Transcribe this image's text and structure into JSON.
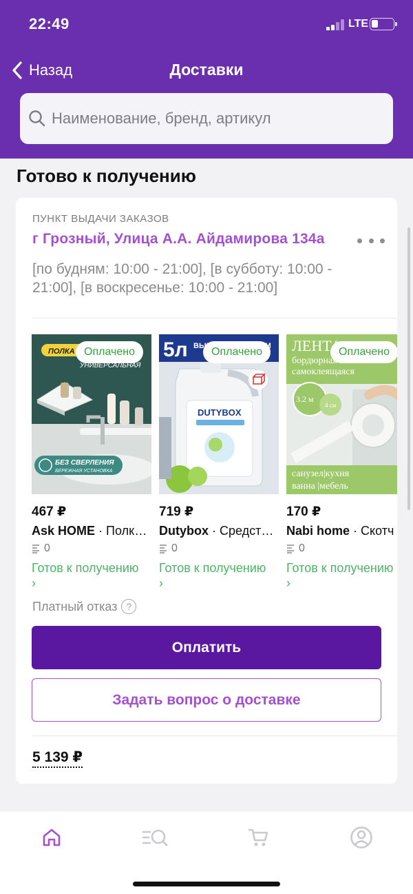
{
  "status_bar": {
    "time": "22:49",
    "network": "LTE"
  },
  "nav": {
    "back_label": "Назад",
    "title": "Доставки"
  },
  "search": {
    "placeholder": "Наименование, бренд, артикул"
  },
  "section": {
    "title": "Готово к получению"
  },
  "pickup": {
    "label": "ПУНКТ ВЫДАЧИ ЗАКАЗОВ",
    "address": "г Грозный, Улица А.А. Айдамирова 134а",
    "hours": "[по будням: 10:00 - 21:00], [в субботу: 10:00 - 21:00], [в воскресенье: 10:00 - 21:00]"
  },
  "products": [
    {
      "badge": "Оплачено",
      "price": "467 ₽",
      "brand": "Ask HOME",
      "name": " · Полка для ванной",
      "reviews": "0",
      "status": "Готов к получению",
      "chevron": "›",
      "image_text": {
        "line1": "ПОЛКА",
        "line2": "УНИВЕРСАЛЬНАЯ",
        "footer1": "БЕЗ СВЕРЛЕНИЯ",
        "footer2": "БЕРЕЖНАЯ УСТАНОВКА"
      },
      "colors": {
        "bg": "#2e5752",
        "badge_text": "#33a33a"
      }
    },
    {
      "badge": "Оплачено",
      "price": "719 ₽",
      "brand": "Dutybox",
      "name": " · Средство для посудомоечной машины",
      "reviews": "0",
      "status": "Готов к получению",
      "chevron": "›",
      "image_text": {
        "volume": "5л",
        "headline": "ВЫГОДНЫЙ ОБЪЕМ",
        "logo": "DUTYBOX"
      },
      "colors": {
        "bg": "#1d3a8f"
      }
    },
    {
      "badge": "Оплачено",
      "price": "170 ₽",
      "brand": "Nabi home",
      "name": " · Скотч",
      "reviews": "0",
      "status": "Готов к получению",
      "chevron": "›",
      "image_text": {
        "line1": "ЛЕНТА",
        "line2": "бордюрная",
        "line3": "самоклеящаяся",
        "size": "3.2 м",
        "width": "4 см",
        "footer1": "санузел|кухня",
        "footer2": "ванна |мебель"
      },
      "colors": {
        "bg": "#9dc86a"
      }
    }
  ],
  "refusal": {
    "label": "Платный отказ",
    "help": "?"
  },
  "buttons": {
    "pay": "Оплатить",
    "ask": "Задать вопрос о доставке"
  },
  "total": "5 139 ₽",
  "colors": {
    "brand": "#6a2fae",
    "accent": "#a54fd1",
    "primary_button": "#5a18a0",
    "status_green": "#4cb564"
  },
  "tabbar": {
    "items": [
      "home-icon",
      "catalog-search-icon",
      "cart-icon",
      "profile-icon"
    ],
    "active": "home-icon"
  }
}
